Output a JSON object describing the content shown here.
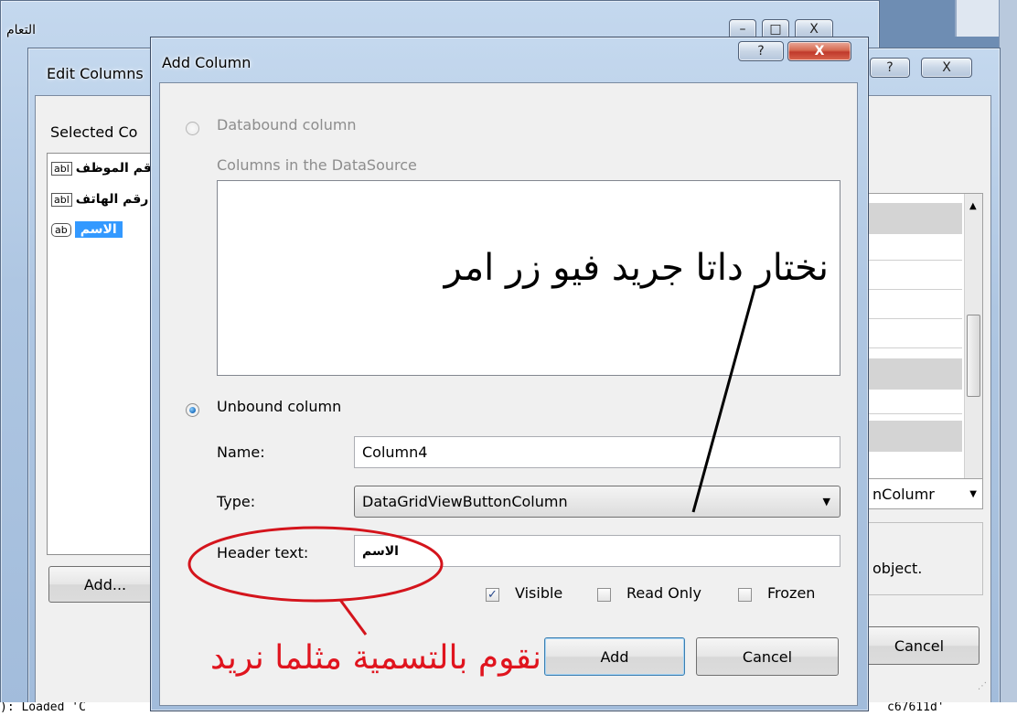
{
  "background_window": {
    "title_fragment": "التعام"
  },
  "edit_columns": {
    "title": "Edit Columns",
    "selected_columns_label": "Selected Co",
    "items": [
      {
        "badge": "abl",
        "text": "رقم الموظف"
      },
      {
        "badge": "abl",
        "text": "رقم الهاتف"
      },
      {
        "badge": "ab",
        "text": "الاسم",
        "selected": true
      }
    ],
    "add_button": "Add...",
    "right_combo_text": "nColumr",
    "right_hint_text": "object.",
    "cancel_button": "Cancel",
    "help_glyph": "?",
    "close_glyph": "X"
  },
  "status_strip": {
    "left_text": "): Loaded 'C",
    "right_text": "c67611d'"
  },
  "add_column": {
    "title": "Add Column",
    "help_glyph": "?",
    "close_glyph": "X",
    "databound_label": "Databound column",
    "columns_in_datasource_label": "Columns in the DataSource",
    "unbound_label": "Unbound column",
    "name_label": "Name:",
    "name_value": "Column4",
    "type_label": "Type:",
    "type_value": "DataGridViewButtonColumn",
    "header_text_label": "Header text:",
    "header_text_value": "الاسم",
    "visible_label": "Visible",
    "readonly_label": "Read Only",
    "frozen_label": "Frozen",
    "visible_checked": true,
    "readonly_checked": false,
    "frozen_checked": false,
    "add_button": "Add",
    "cancel_button": "Cancel"
  },
  "annotations": {
    "top_note": "نختار داتا جريد فيو زر امر",
    "bottom_note": "نقوم بالتسمية مثلما نريد",
    "bottom_note_color": "#e0141e",
    "ellipse_color": "#d4141c"
  }
}
